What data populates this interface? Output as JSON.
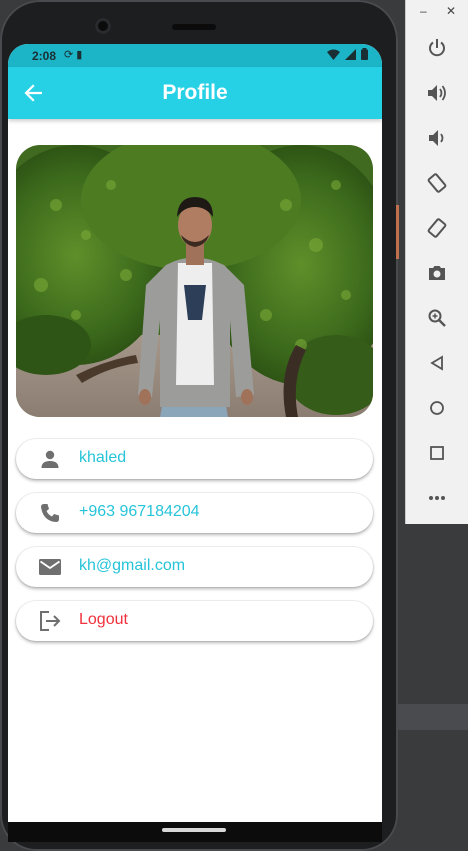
{
  "status_bar": {
    "time": "2:08",
    "left_icons": [
      "sync-icon",
      "sd-card-icon"
    ],
    "right_icons": [
      "wifi-icon",
      "signal-icon",
      "battery-icon"
    ]
  },
  "app_bar": {
    "title": "Profile",
    "back_icon": "arrow-back-icon",
    "color": "#26d1e6"
  },
  "profile_photo": {
    "description_icon": "person-photo"
  },
  "tiles": [
    {
      "icon": "person-icon",
      "text": "khaled"
    },
    {
      "icon": "phone-icon",
      "text": "+963 967184204"
    },
    {
      "icon": "email-icon",
      "text": "kh@gmail.com"
    },
    {
      "icon": "logout-icon",
      "text": "Logout"
    }
  ],
  "colors": {
    "accent": "#26c4d9",
    "logout": "#f0303c",
    "icon_gray": "#6f6f6f"
  },
  "emulator_panel": {
    "window_controls": [
      "minimize-icon",
      "close-icon"
    ],
    "buttons": [
      "power-icon",
      "volume-up-icon",
      "volume-down-icon",
      "rotate-left-icon",
      "rotate-right-icon",
      "camera-icon",
      "zoom-icon",
      "back-triangle-icon",
      "home-circle-icon",
      "overview-square-icon",
      "more-icon"
    ]
  }
}
